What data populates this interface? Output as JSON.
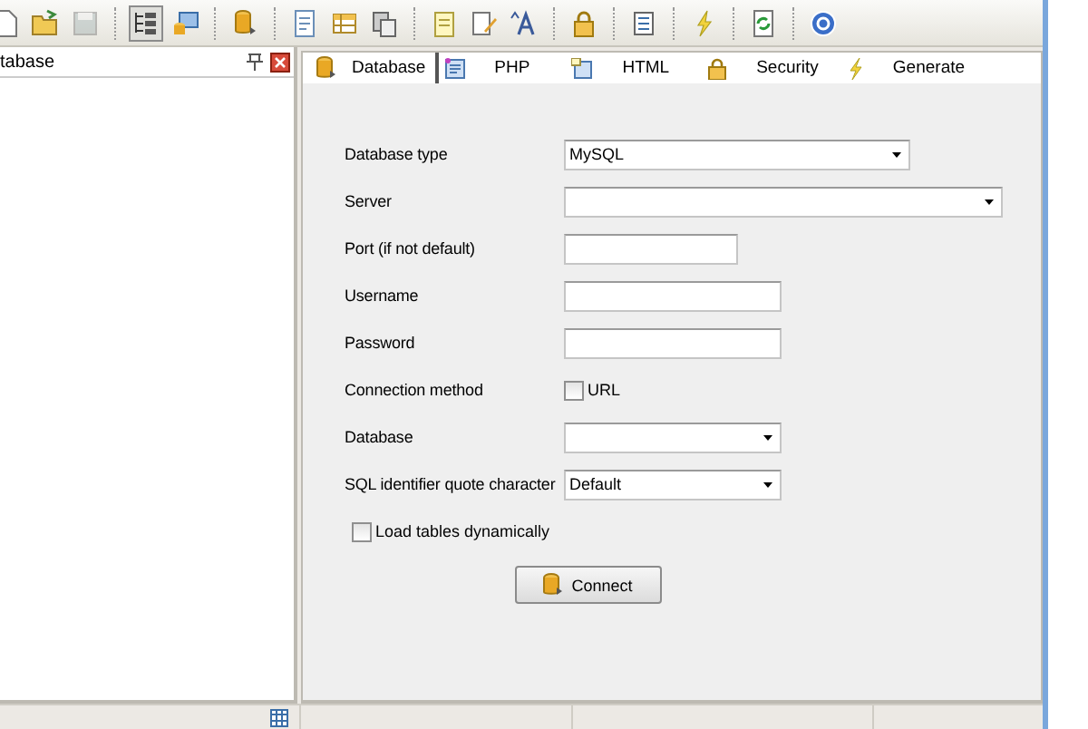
{
  "toolbar": [
    {
      "kind": "button",
      "pressed": false,
      "disabled": false
    },
    {
      "kind": "button",
      "pressed": false,
      "disabled": false
    },
    {
      "kind": "button",
      "pressed": false,
      "disabled": true
    },
    {
      "kind": "separator"
    },
    {
      "kind": "button",
      "pressed": true,
      "disabled": false
    },
    {
      "kind": "button",
      "pressed": false,
      "disabled": false
    },
    {
      "kind": "separator"
    },
    {
      "kind": "button",
      "pressed": false,
      "disabled": false
    },
    {
      "kind": "separator"
    },
    {
      "kind": "button",
      "pressed": false,
      "disabled": false
    },
    {
      "kind": "button",
      "pressed": false,
      "disabled": false
    },
    {
      "kind": "button",
      "pressed": false,
      "disabled": false
    },
    {
      "kind": "separator"
    },
    {
      "kind": "button",
      "pressed": false,
      "disabled": false
    },
    {
      "kind": "button",
      "pressed": false,
      "disabled": false
    },
    {
      "kind": "button",
      "pressed": false,
      "disabled": false
    },
    {
      "kind": "separator"
    },
    {
      "kind": "button",
      "pressed": false,
      "disabled": false
    },
    {
      "kind": "separator"
    },
    {
      "kind": "button",
      "pressed": false,
      "disabled": false
    },
    {
      "kind": "separator"
    },
    {
      "kind": "button",
      "pressed": false,
      "disabled": false
    },
    {
      "kind": "separator"
    },
    {
      "kind": "button",
      "pressed": false,
      "disabled": false
    },
    {
      "kind": "separator"
    },
    {
      "kind": "button",
      "pressed": false,
      "disabled": false
    }
  ],
  "side_panel": {
    "title": "tabase"
  },
  "tabs": [
    {
      "label": "Database",
      "selected": true
    },
    {
      "label": "PHP",
      "selected": false
    },
    {
      "label": "HTML",
      "selected": false
    },
    {
      "label": "Security",
      "selected": false
    },
    {
      "label": "Generate",
      "selected": false
    }
  ],
  "form": [
    {
      "kind": "select",
      "label": "Database type",
      "value": "MySQL"
    },
    {
      "kind": "select",
      "label": "Server"
    },
    {
      "kind": "text",
      "label": "Port (if not default)"
    },
    {
      "kind": "text",
      "label": "Username"
    },
    {
      "kind": "password",
      "label": "Password"
    },
    {
      "kind": "checkbox",
      "label": "Connection method",
      "option": "URL",
      "checked": false
    },
    {
      "kind": "select",
      "label": "Database"
    },
    {
      "kind": "select",
      "label": "SQL identifier quote character",
      "value": "Default"
    }
  ],
  "load_tables": {
    "label": "Load tables dynamically",
    "checked": false
  },
  "connect_button": {
    "label": "Connect"
  }
}
